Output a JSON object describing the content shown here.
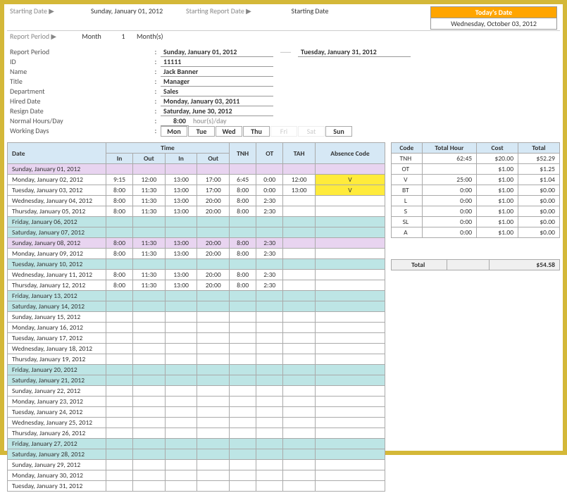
{
  "top": {
    "starting_date_label": "Starting Date ▶",
    "starting_date": "Sunday, January 01, 2012",
    "starting_report_label": "Starting Report Date ▶",
    "starting_report": "Starting Date",
    "report_period_label": "Report Period ▶",
    "period_type": "Month",
    "period_num": "1",
    "period_unit": "Month(s)",
    "today_label": "Today's Date",
    "today_val": "Wednesday, October 03, 2012"
  },
  "info": {
    "report_period_label": "Report Period",
    "report_period_from": "Sunday, January 01, 2012",
    "report_period_sep": "───",
    "report_period_to": "Tuesday, January 31, 2012",
    "id_label": "ID",
    "id": "11111",
    "name_label": "Name",
    "name": "Jack Banner",
    "title_label": "Title",
    "title": "Manager",
    "dept_label": "Department",
    "dept": "Sales",
    "hired_label": "Hired Date",
    "hired": "Monday, January 03, 2011",
    "resign_label": "Resign Date",
    "resign": "Saturday, June 30, 2012",
    "hours_label": "Normal Hours/Day",
    "hours": "8:00",
    "hours_suffix": "hour(s)/day",
    "days_label": "Working Days",
    "days": [
      "Mon",
      "Tue",
      "Wed",
      "Thu",
      "Fri",
      "Sat",
      "Sun"
    ],
    "days_enabled": [
      true,
      true,
      true,
      true,
      false,
      false,
      true
    ]
  },
  "headers": {
    "date": "Date",
    "time": "Time",
    "in": "In",
    "out": "Out",
    "tnh": "TNH",
    "ot": "OT",
    "tah": "TAH",
    "absence": "Absence Code"
  },
  "rows": [
    {
      "date": "Sunday, January 01, 2012",
      "cls": "row-sun",
      "in1": "",
      "out1": "",
      "in2": "",
      "out2": "",
      "tnh": "",
      "ot": "",
      "tah": "",
      "abs": ""
    },
    {
      "date": "Monday, January 02, 2012",
      "cls": "",
      "in1": "9:15",
      "out1": "12:00",
      "in2": "13:00",
      "out2": "17:00",
      "tnh": "6:45",
      "ot": "0:00",
      "tah": "12:00",
      "abs": "V"
    },
    {
      "date": "Tuesday, January 03, 2012",
      "cls": "",
      "in1": "8:00",
      "out1": "11:30",
      "in2": "13:00",
      "out2": "17:00",
      "tnh": "8:00",
      "ot": "0:00",
      "tah": "13:00",
      "abs": "V"
    },
    {
      "date": "Wednesday, January 04, 2012",
      "cls": "",
      "in1": "8:00",
      "out1": "11:30",
      "in2": "13:00",
      "out2": "20:00",
      "tnh": "8:00",
      "ot": "2:30",
      "tah": "",
      "abs": ""
    },
    {
      "date": "Thursday, January 05, 2012",
      "cls": "",
      "in1": "8:00",
      "out1": "11:30",
      "in2": "13:00",
      "out2": "20:00",
      "tnh": "8:00",
      "ot": "2:30",
      "tah": "",
      "abs": ""
    },
    {
      "date": "Friday, January 06, 2012",
      "cls": "row-fri",
      "in1": "",
      "out1": "",
      "in2": "",
      "out2": "",
      "tnh": "",
      "ot": "",
      "tah": "",
      "abs": ""
    },
    {
      "date": "Saturday, January 07, 2012",
      "cls": "row-sat",
      "in1": "",
      "out1": "",
      "in2": "",
      "out2": "",
      "tnh": "",
      "ot": "",
      "tah": "",
      "abs": ""
    },
    {
      "date": "Sunday, January 08, 2012",
      "cls": "row-sun",
      "in1": "8:00",
      "out1": "11:30",
      "in2": "13:00",
      "out2": "20:00",
      "tnh": "8:00",
      "ot": "2:30",
      "tah": "",
      "abs": ""
    },
    {
      "date": "Monday, January 09, 2012",
      "cls": "",
      "in1": "8:00",
      "out1": "11:30",
      "in2": "13:00",
      "out2": "20:00",
      "tnh": "8:00",
      "ot": "2:30",
      "tah": "",
      "abs": ""
    },
    {
      "date": "Tuesday, January 10, 2012",
      "cls": "row-tue-h",
      "in1": "",
      "out1": "",
      "in2": "",
      "out2": "",
      "tnh": "",
      "ot": "",
      "tah": "",
      "abs": ""
    },
    {
      "date": "Wednesday, January 11, 2012",
      "cls": "",
      "in1": "8:00",
      "out1": "11:30",
      "in2": "13:00",
      "out2": "20:00",
      "tnh": "8:00",
      "ot": "2:30",
      "tah": "",
      "abs": ""
    },
    {
      "date": "Thursday, January 12, 2012",
      "cls": "",
      "in1": "8:00",
      "out1": "11:30",
      "in2": "13:00",
      "out2": "20:00",
      "tnh": "8:00",
      "ot": "2:30",
      "tah": "",
      "abs": ""
    },
    {
      "date": "Friday, January 13, 2012",
      "cls": "row-fri",
      "in1": "",
      "out1": "",
      "in2": "",
      "out2": "",
      "tnh": "",
      "ot": "",
      "tah": "",
      "abs": ""
    },
    {
      "date": "Saturday, January 14, 2012",
      "cls": "row-sat",
      "in1": "",
      "out1": "",
      "in2": "",
      "out2": "",
      "tnh": "",
      "ot": "",
      "tah": "",
      "abs": ""
    },
    {
      "date": "Sunday, January 15, 2012",
      "cls": "",
      "in1": "",
      "out1": "",
      "in2": "",
      "out2": "",
      "tnh": "",
      "ot": "",
      "tah": "",
      "abs": ""
    },
    {
      "date": "Monday, January 16, 2012",
      "cls": "",
      "in1": "",
      "out1": "",
      "in2": "",
      "out2": "",
      "tnh": "",
      "ot": "",
      "tah": "",
      "abs": ""
    },
    {
      "date": "Tuesday, January 17, 2012",
      "cls": "",
      "in1": "",
      "out1": "",
      "in2": "",
      "out2": "",
      "tnh": "",
      "ot": "",
      "tah": "",
      "abs": ""
    },
    {
      "date": "Wednesday, January 18, 2012",
      "cls": "",
      "in1": "",
      "out1": "",
      "in2": "",
      "out2": "",
      "tnh": "",
      "ot": "",
      "tah": "",
      "abs": ""
    },
    {
      "date": "Thursday, January 19, 2012",
      "cls": "",
      "in1": "",
      "out1": "",
      "in2": "",
      "out2": "",
      "tnh": "",
      "ot": "",
      "tah": "",
      "abs": ""
    },
    {
      "date": "Friday, January 20, 2012",
      "cls": "row-fri",
      "in1": "",
      "out1": "",
      "in2": "",
      "out2": "",
      "tnh": "",
      "ot": "",
      "tah": "",
      "abs": ""
    },
    {
      "date": "Saturday, January 21, 2012",
      "cls": "row-sat",
      "in1": "",
      "out1": "",
      "in2": "",
      "out2": "",
      "tnh": "",
      "ot": "",
      "tah": "",
      "abs": ""
    },
    {
      "date": "Sunday, January 22, 2012",
      "cls": "",
      "in1": "",
      "out1": "",
      "in2": "",
      "out2": "",
      "tnh": "",
      "ot": "",
      "tah": "",
      "abs": ""
    },
    {
      "date": "Monday, January 23, 2012",
      "cls": "",
      "in1": "",
      "out1": "",
      "in2": "",
      "out2": "",
      "tnh": "",
      "ot": "",
      "tah": "",
      "abs": ""
    },
    {
      "date": "Tuesday, January 24, 2012",
      "cls": "",
      "in1": "",
      "out1": "",
      "in2": "",
      "out2": "",
      "tnh": "",
      "ot": "",
      "tah": "",
      "abs": ""
    },
    {
      "date": "Wednesday, January 25, 2012",
      "cls": "",
      "in1": "",
      "out1": "",
      "in2": "",
      "out2": "",
      "tnh": "",
      "ot": "",
      "tah": "",
      "abs": ""
    },
    {
      "date": "Thursday, January 26, 2012",
      "cls": "",
      "in1": "",
      "out1": "",
      "in2": "",
      "out2": "",
      "tnh": "",
      "ot": "",
      "tah": "",
      "abs": ""
    },
    {
      "date": "Friday, January 27, 2012",
      "cls": "row-fri",
      "in1": "",
      "out1": "",
      "in2": "",
      "out2": "",
      "tnh": "",
      "ot": "",
      "tah": "",
      "abs": ""
    },
    {
      "date": "Saturday, January 28, 2012",
      "cls": "row-sat",
      "in1": "",
      "out1": "",
      "in2": "",
      "out2": "",
      "tnh": "",
      "ot": "",
      "tah": "",
      "abs": ""
    },
    {
      "date": "Sunday, January 29, 2012",
      "cls": "",
      "in1": "",
      "out1": "",
      "in2": "",
      "out2": "",
      "tnh": "",
      "ot": "",
      "tah": "",
      "abs": ""
    },
    {
      "date": "Monday, January 30, 2012",
      "cls": "",
      "in1": "",
      "out1": "",
      "in2": "",
      "out2": "",
      "tnh": "",
      "ot": "",
      "tah": "",
      "abs": ""
    },
    {
      "date": "Tuesday, January 31, 2012",
      "cls": "",
      "in1": "",
      "out1": "",
      "in2": "",
      "out2": "",
      "tnh": "",
      "ot": "",
      "tah": "",
      "abs": ""
    }
  ],
  "summary": {
    "headers": {
      "code": "Code",
      "th": "Total Hour",
      "cost": "Cost",
      "total": "Total"
    },
    "rows": [
      {
        "code": "TNH",
        "th": "62:45",
        "cost": "$20.00",
        "total": "$52.29"
      },
      {
        "code": "OT",
        "th": "",
        "cost": "$1.00",
        "total": "$1.25"
      },
      {
        "code": "V",
        "th": "25:00",
        "cost": "$1.00",
        "total": "$1.04"
      },
      {
        "code": "BT",
        "th": "0:00",
        "cost": "$1.00",
        "total": "$0.00"
      },
      {
        "code": "L",
        "th": "0:00",
        "cost": "$1.00",
        "total": "$0.00"
      },
      {
        "code": "S",
        "th": "0:00",
        "cost": "$1.00",
        "total": "$0.00"
      },
      {
        "code": "SL",
        "th": "0:00",
        "cost": "$1.00",
        "total": "$0.00"
      },
      {
        "code": "A",
        "th": "0:00",
        "cost": "$1.00",
        "total": "$0.00"
      }
    ],
    "total_label": "Total",
    "total_val": "$54.58"
  }
}
